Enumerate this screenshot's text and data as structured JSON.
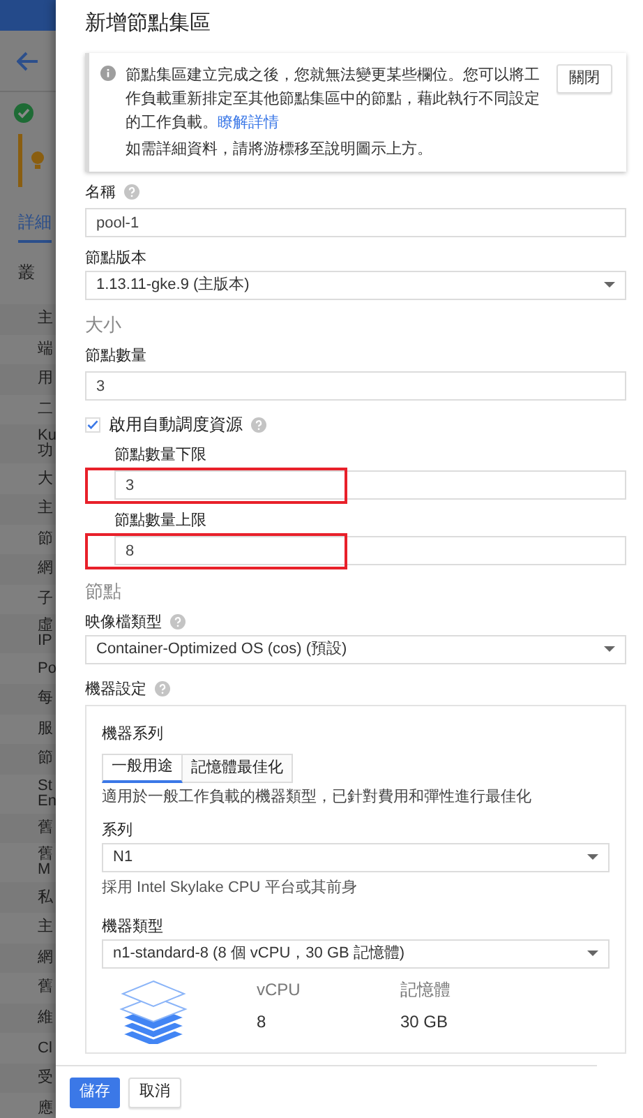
{
  "background": {
    "tab": {
      "label": "詳細",
      "selected": true
    },
    "heading": "叢",
    "items": [
      {
        "lines": [
          "主"
        ]
      },
      {
        "lines": [
          "端"
        ]
      },
      {
        "lines": [
          "用"
        ]
      },
      {
        "lines": [
          "二"
        ]
      },
      {
        "lines": [
          "Ku",
          "功"
        ]
      },
      {
        "lines": [
          "大"
        ]
      },
      {
        "lines": [
          "主"
        ]
      },
      {
        "lines": [
          "節"
        ]
      },
      {
        "lines": [
          "網"
        ]
      },
      {
        "lines": [
          "子"
        ]
      },
      {
        "lines": [
          "虛",
          "IP"
        ]
      },
      {
        "lines": [
          "Po"
        ]
      },
      {
        "lines": [
          "每"
        ]
      },
      {
        "lines": [
          "服"
        ]
      },
      {
        "lines": [
          "節"
        ]
      },
      {
        "lines": [
          "St",
          "En"
        ]
      },
      {
        "lines": [
          "舊"
        ]
      },
      {
        "lines": [
          "舊",
          "M"
        ]
      },
      {
        "lines": [
          "私"
        ]
      },
      {
        "lines": [
          "主"
        ]
      },
      {
        "lines": [
          "網"
        ]
      },
      {
        "lines": [
          "舊"
        ]
      },
      {
        "lines": [
          "維"
        ]
      },
      {
        "lines": [
          "Cl"
        ]
      },
      {
        "lines": [
          "受"
        ]
      },
      {
        "lines": [
          "應"
        ]
      }
    ]
  },
  "panel": {
    "title": "新增節點集區",
    "notice": {
      "text": "節點集區建立完成之後，您就無法變更某些欄位。您可以將工作負載重新排定至其他節點集區中的節點，藉此執行不同設定的工作負載。",
      "link": "瞭解詳情",
      "hint": "如需詳細資料，請將游標移至說明圖示上方。",
      "close": "關閉"
    },
    "fields": [
      {
        "kind": "input",
        "label": "名稱",
        "help": true,
        "value": "pool-1",
        "highlighted": false
      },
      {
        "kind": "select",
        "label": "節點版本",
        "help": false,
        "value": "1.13.11-gke.9 (主版本)"
      },
      {
        "kind": "section",
        "label": "大小"
      },
      {
        "kind": "input",
        "label": "節點數量",
        "help": false,
        "value": "3",
        "highlighted": false
      },
      {
        "kind": "checkbox",
        "label": "啟用自動調度資源",
        "help": true,
        "checked": true
      },
      {
        "kind": "input",
        "label": "節點數量下限",
        "help": false,
        "value": "3",
        "indented": true,
        "highlighted": true
      },
      {
        "kind": "input",
        "label": "節點數量上限",
        "help": false,
        "value": "8",
        "indented": true,
        "highlighted": true
      },
      {
        "kind": "section",
        "label": "節點"
      },
      {
        "kind": "select",
        "label": "映像檔類型",
        "help": true,
        "value": "Container-Optimized OS (cos) (預設)"
      }
    ],
    "machine": {
      "label": "機器設定",
      "help": true,
      "series_label": "機器系列",
      "tabs": [
        {
          "label": "一般用途",
          "selected": true
        },
        {
          "label": "記憶體最佳化",
          "selected": false
        }
      ],
      "description": "適用於一般工作負載的機器類型，已針對費用和彈性進行最佳化",
      "family": {
        "label": "系列",
        "value": "N1",
        "hint": "採用 Intel Skylake CPU 平台或其前身"
      },
      "type": {
        "label": "機器類型",
        "value": "n1-standard-8 (8 個 vCPU，30 GB 記憶體)"
      },
      "specs": [
        {
          "label": "vCPU",
          "value": "8"
        },
        {
          "label": "記憶體",
          "value": "30 GB"
        }
      ]
    },
    "buttons": [
      {
        "label": "儲存",
        "kind": "primary"
      },
      {
        "label": "取消",
        "kind": "secondary"
      }
    ]
  }
}
